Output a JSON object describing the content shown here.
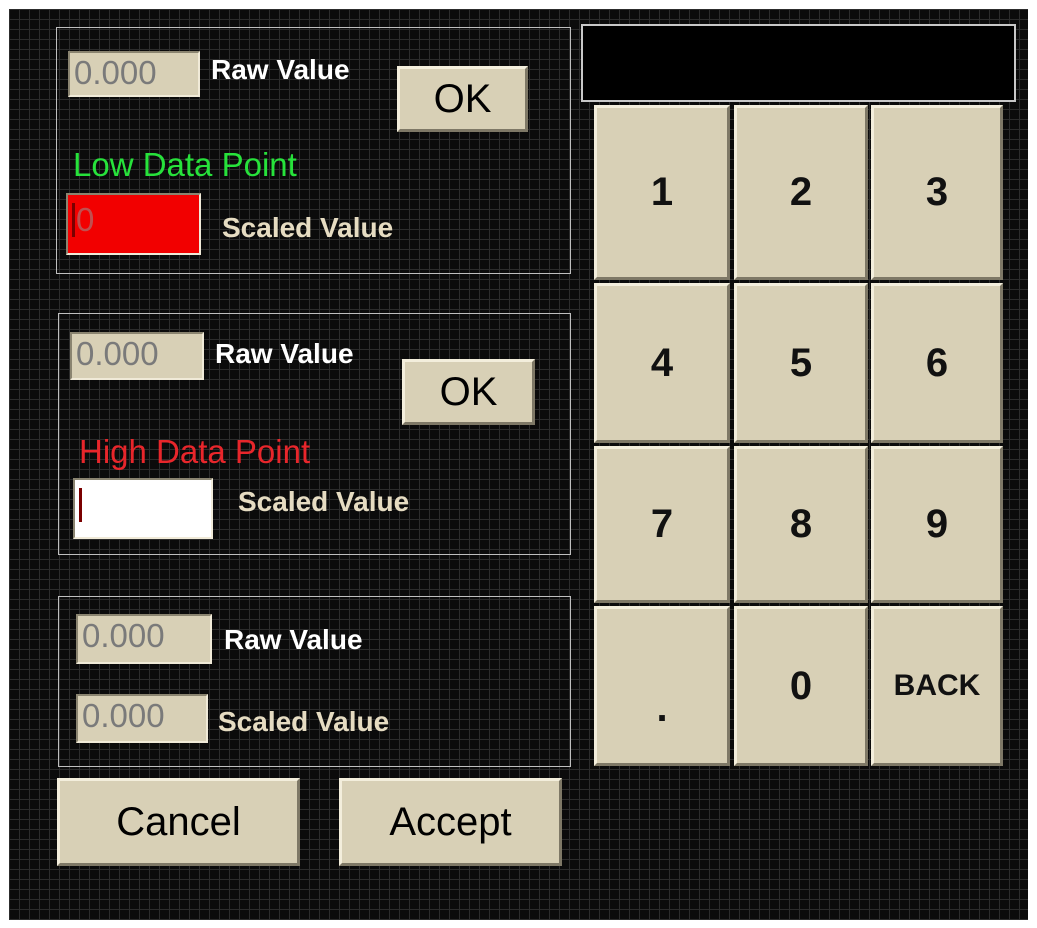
{
  "colors": {
    "background": "#0b0b0b",
    "grid": "#2c2c2c",
    "button_face": "#d8d0b6",
    "low_title": "#27e23b",
    "high_title": "#e8262b",
    "active_field": "#f20000"
  },
  "low_point": {
    "raw_value": "0.000",
    "raw_label": "Raw Value",
    "ok_label": "OK",
    "title": "Low Data Point",
    "scaled_value": "0",
    "scaled_label": "Scaled Value"
  },
  "high_point": {
    "raw_value": "0.000",
    "raw_label": "Raw Value",
    "ok_label": "OK",
    "title": "High Data Point",
    "scaled_value": "",
    "scaled_label": "Scaled Value"
  },
  "current": {
    "raw_value": "0.000",
    "raw_label": "Raw Value",
    "scaled_value": "0.000",
    "scaled_label": "Scaled Value"
  },
  "actions": {
    "cancel_label": "Cancel",
    "accept_label": "Accept"
  },
  "keypad": {
    "display_value": "",
    "keys": [
      "1",
      "2",
      "3",
      "4",
      "5",
      "6",
      "7",
      "8",
      "9",
      ".",
      "0",
      "BACK"
    ]
  }
}
